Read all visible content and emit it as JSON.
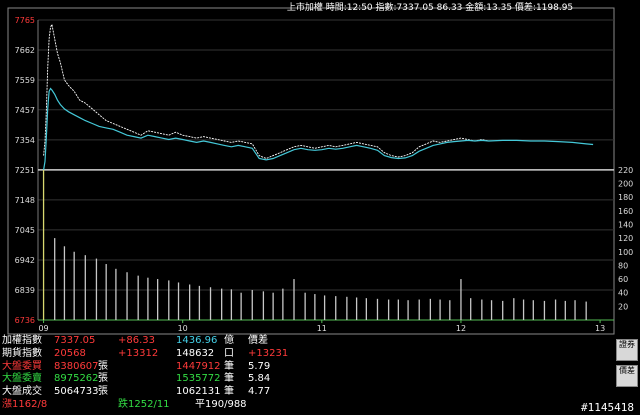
{
  "header": {
    "text": "上市加權 時間:12:50 指數:7337.05 86.33 金額:13.35 價差:1198.95"
  },
  "chart_data": {
    "type": "line",
    "y_ticks": [
      "7765",
      "7662",
      "7559",
      "7457",
      "7354",
      "7251",
      "7148",
      "7045",
      "6942",
      "6839",
      "6736"
    ],
    "ylim": [
      6736,
      7765
    ],
    "volume_ticks": [
      "220",
      "200",
      "180",
      "160",
      "140",
      "120",
      "100",
      "80",
      "60",
      "40",
      "20"
    ],
    "volume_lim": [
      0,
      220
    ],
    "x_ticks": [
      "09",
      "10",
      "11",
      "12",
      "13"
    ],
    "reference_level": 7251,
    "series": [
      {
        "color": "#ffffff",
        "x": [
          9.0,
          9.01,
          9.02,
          9.03,
          9.04,
          9.05,
          9.06,
          9.08,
          9.1,
          9.12,
          9.15,
          9.18,
          9.22,
          9.26,
          9.3,
          9.35,
          9.4,
          9.45,
          9.5,
          9.55,
          9.6,
          9.65,
          9.7,
          9.75,
          9.8,
          9.85,
          9.9,
          9.95,
          10.0,
          10.05,
          10.1,
          10.15,
          10.2,
          10.25,
          10.3,
          10.35,
          10.4,
          10.45,
          10.5,
          10.55,
          10.6,
          10.65,
          10.7,
          10.75,
          10.8,
          10.85,
          10.9,
          10.95,
          11.0,
          11.05,
          11.1,
          11.15,
          11.2,
          11.25,
          11.3,
          11.35,
          11.4,
          11.45,
          11.5,
          11.55,
          11.6,
          11.65,
          11.7,
          11.75,
          11.8,
          11.85,
          11.9,
          11.95,
          12.0,
          12.05,
          12.1,
          12.15,
          12.2
        ],
        "values": [
          7300,
          7350,
          7450,
          7600,
          7700,
          7740,
          7750,
          7700,
          7650,
          7620,
          7560,
          7540,
          7520,
          7490,
          7480,
          7460,
          7440,
          7420,
          7410,
          7400,
          7390,
          7380,
          7370,
          7385,
          7380,
          7375,
          7370,
          7380,
          7370,
          7365,
          7360,
          7365,
          7360,
          7355,
          7350,
          7345,
          7350,
          7345,
          7340,
          7300,
          7290,
          7300,
          7310,
          7320,
          7330,
          7335,
          7330,
          7325,
          7330,
          7335,
          7330,
          7335,
          7340,
          7345,
          7340,
          7335,
          7330,
          7310,
          7300,
          7295,
          7300,
          7310,
          7330,
          7340,
          7350,
          7345,
          7350,
          7355,
          7360,
          7355,
          7350,
          7355,
          7350
        ]
      },
      {
        "color": "#44c8d8",
        "x": [
          9.0,
          9.01,
          9.02,
          9.03,
          9.04,
          9.05,
          9.06,
          9.08,
          9.1,
          9.12,
          9.15,
          9.18,
          9.22,
          9.26,
          9.3,
          9.35,
          9.4,
          9.45,
          9.5,
          9.55,
          9.6,
          9.65,
          9.7,
          9.75,
          9.8,
          9.85,
          9.9,
          9.95,
          10.0,
          10.05,
          10.1,
          10.15,
          10.2,
          10.25,
          10.3,
          10.35,
          10.4,
          10.45,
          10.5,
          10.55,
          10.6,
          10.65,
          10.7,
          10.75,
          10.8,
          10.85,
          10.9,
          10.95,
          11.0,
          11.05,
          11.1,
          11.15,
          11.2,
          11.25,
          11.3,
          11.35,
          11.4,
          11.45,
          11.5,
          11.55,
          11.6,
          11.65,
          11.7,
          11.75,
          11.8,
          11.85,
          11.9,
          11.95,
          12.0,
          12.05,
          12.1,
          12.15,
          12.2,
          12.3,
          12.4,
          12.5,
          12.6,
          12.7,
          12.8,
          12.9,
          12.95
        ],
        "values": [
          7251,
          7280,
          7360,
          7460,
          7520,
          7530,
          7525,
          7510,
          7490,
          7475,
          7460,
          7450,
          7440,
          7430,
          7420,
          7410,
          7400,
          7395,
          7390,
          7380,
          7370,
          7365,
          7360,
          7370,
          7365,
          7360,
          7355,
          7360,
          7355,
          7350,
          7345,
          7350,
          7345,
          7340,
          7335,
          7330,
          7335,
          7330,
          7325,
          7290,
          7285,
          7290,
          7300,
          7310,
          7320,
          7325,
          7320,
          7318,
          7320,
          7325,
          7322,
          7325,
          7330,
          7335,
          7330,
          7325,
          7318,
          7300,
          7293,
          7290,
          7292,
          7300,
          7315,
          7325,
          7335,
          7340,
          7345,
          7348,
          7350,
          7352,
          7350,
          7352,
          7350,
          7352,
          7352,
          7350,
          7350,
          7348,
          7345,
          7340,
          7338
        ]
      }
    ],
    "volume": {
      "x": [
        9.0,
        9.08,
        9.15,
        9.22,
        9.3,
        9.38,
        9.45,
        9.52,
        9.6,
        9.68,
        9.75,
        9.82,
        9.9,
        9.97,
        10.05,
        10.12,
        10.2,
        10.28,
        10.35,
        10.42,
        10.5,
        10.58,
        10.65,
        10.72,
        10.8,
        10.88,
        10.95,
        11.02,
        11.1,
        11.18,
        11.25,
        11.32,
        11.4,
        11.48,
        11.55,
        11.62,
        11.7,
        11.78,
        11.85,
        11.92,
        12.0,
        12.07,
        12.15,
        12.22,
        12.3,
        12.38,
        12.45,
        12.52,
        12.6,
        12.68,
        12.75,
        12.82,
        12.9
      ],
      "values": [
        220,
        120,
        108,
        100,
        95,
        90,
        82,
        75,
        70,
        65,
        62,
        60,
        58,
        55,
        52,
        50,
        48,
        46,
        45,
        40,
        44,
        42,
        40,
        46,
        60,
        40,
        38,
        36,
        35,
        34,
        33,
        32,
        31,
        30,
        30,
        29,
        30,
        31,
        30,
        29,
        60,
        32,
        30,
        29,
        28,
        32,
        30,
        29,
        28,
        30,
        28,
        29,
        27
      ]
    }
  },
  "info": {
    "rows": [
      {
        "label": "加權指數",
        "v1": "7337.05",
        "v2": "+86.33",
        "v3": "1436.96",
        "u3": "億",
        "v4": "價差",
        "c1": "c-red",
        "c2": "c-red",
        "c3": "c-cyan"
      },
      {
        "label": "期貨指數",
        "v1": "20568",
        "v2": "+13312",
        "v3": "148632",
        "u3": "口",
        "v4": "+13231",
        "c1": "c-red",
        "c2": "c-red",
        "c3": "c-white"
      },
      {
        "label": "大盤委買",
        "v1": "8380607",
        "u1": "張",
        "v3": "1447912",
        "u3": "筆",
        "v4": "5.79",
        "c1": "c-red",
        "c3": "c-red"
      },
      {
        "label": "大盤委賣",
        "v1": "8975262",
        "u1": "張",
        "v3": "1535772",
        "u3": "筆",
        "v4": "5.84",
        "c1": "c-green",
        "c3": "c-green"
      },
      {
        "label": "大盤成交",
        "v1": "5064733",
        "u1": "張",
        "v3": "1062131",
        "u3": "筆",
        "v4": "4.77",
        "c1": "c-white",
        "c3": "c-white"
      },
      {
        "label": "漲1162/8",
        "v2": "跌1252/11",
        "v3": "平",
        "v4": "190/988"
      }
    ]
  },
  "side": {
    "btn1": "證券",
    "btn2": "價差"
  },
  "watermark": "#1145418"
}
